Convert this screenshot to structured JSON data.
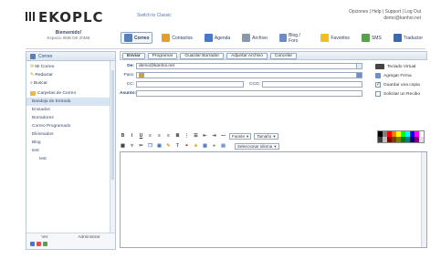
{
  "header": {
    "logo": "EKOPLC",
    "switch_link": "Switch to Classic",
    "top_links": "Opciones | Help | Support | Log Out",
    "user_email": "demo@kanhoi.net"
  },
  "welcome": {
    "title": "Bienvenido!",
    "subtitle": "Espacio 0MB DE 20MB"
  },
  "nav": [
    {
      "label": "Correo",
      "icon": "mail-icon",
      "color": "#5b7fb5"
    },
    {
      "label": "Contactos",
      "icon": "contacts-icon",
      "color": "#e0a030"
    },
    {
      "label": "Agenda",
      "icon": "calendar-icon",
      "color": "#4a78c8"
    },
    {
      "label": "Archivo",
      "icon": "archive-icon",
      "color": "#8899aa"
    },
    {
      "label": "Blog / Foro",
      "icon": "blog-icon",
      "color": "#6d8bc4"
    },
    {
      "label": "Favoritos",
      "icon": "favorites-icon",
      "color": "#f0c020"
    },
    {
      "label": "SMS",
      "icon": "sms-icon",
      "color": "#58a04a"
    },
    {
      "label": "Traductor",
      "icon": "translator-icon",
      "color": "#3a6ab0"
    }
  ],
  "sidebar": {
    "header": "Correo",
    "items": [
      {
        "label": "Mi Correo"
      },
      {
        "label": "Redactar"
      },
      {
        "label": "Buscar"
      }
    ],
    "folders_header": "Carpetas de Correo",
    "folders": [
      {
        "label": "Bandeja de Entrada",
        "selected": true
      },
      {
        "label": "Enviados"
      },
      {
        "label": "Borradores"
      },
      {
        "label": "Correo Programado"
      },
      {
        "label": "Eliminados"
      },
      {
        "label": "Blog"
      },
      {
        "label": "test"
      },
      {
        "label": "test"
      }
    ],
    "footer_links": [
      "Ver",
      "Administrar"
    ]
  },
  "compose": {
    "buttons": [
      "Enviar",
      "Programar",
      "Guardar Borrador",
      "Adjuntar Archivo",
      "Cancelar"
    ],
    "de_label": "De:",
    "de_value": "demo@kanhoi.net",
    "para_label": "Para:",
    "cc_label": "CC:",
    "cco_label": "CCO:",
    "asunto_label": "Asunto:",
    "options": [
      {
        "label": "Teclado Virtual",
        "checked": false
      },
      {
        "label": "Agregar Firma",
        "checked": false
      },
      {
        "label": "Guardar una copia",
        "checked": true
      },
      {
        "label": "Solicitar un Recibo",
        "checked": false
      }
    ],
    "font_select": "Fuente",
    "size_select": "Tamaño",
    "lang_select": "Seleccionar Idioma"
  },
  "palette_colors": [
    "#000000",
    "#7f7f7f",
    "#ff0000",
    "#ff7f00",
    "#ffff00",
    "#00ff00",
    "#00ffff",
    "#0000ff",
    "#ff00ff",
    "#ffffff",
    "#3f3f3f",
    "#bfbfbf",
    "#7f0000",
    "#7f3f00",
    "#7f7f00",
    "#007f00",
    "#007f7f",
    "#00007f",
    "#7f007f",
    "#dfdfdf"
  ]
}
